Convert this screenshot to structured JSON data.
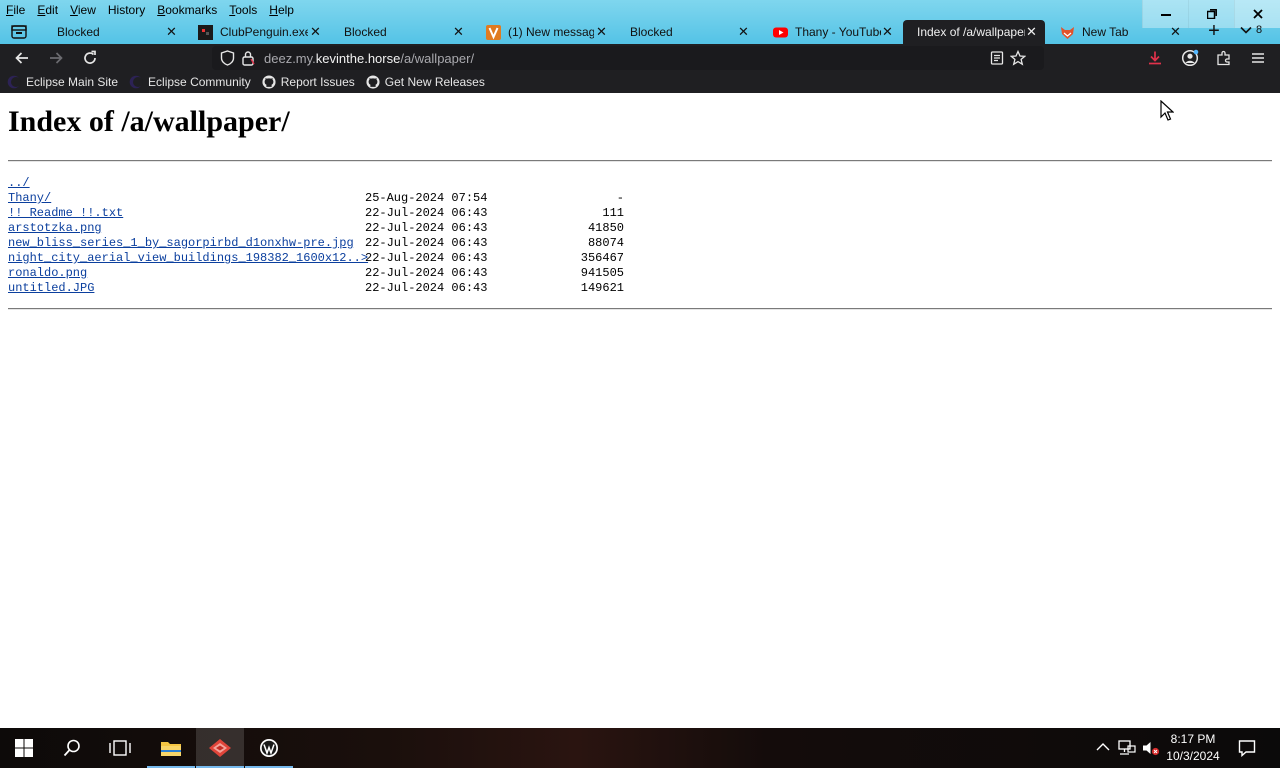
{
  "menubar": [
    "File",
    "Edit",
    "View",
    "History",
    "Bookmarks",
    "Tools",
    "Help"
  ],
  "tabs": [
    {
      "title": "Blocked",
      "icon": "none"
    },
    {
      "title": "ClubPenguin.exe",
      "icon": "clubpenguin-icon"
    },
    {
      "title": "Blocked",
      "icon": "none"
    },
    {
      "title": "(1) New message",
      "icon": "v-icon"
    },
    {
      "title": "Blocked",
      "icon": "none"
    },
    {
      "title": "Thany - YouTube",
      "icon": "youtube-icon"
    },
    {
      "title": "Index of /a/wallpaper/",
      "icon": "none",
      "active": true
    },
    {
      "title": "New Tab",
      "icon": "fox-icon"
    }
  ],
  "alltabs_count": "8",
  "url": {
    "prefix": "deez.my.",
    "host": "kevinthe.horse",
    "path": "/a/wallpaper/"
  },
  "bookmarks": [
    {
      "label": "Eclipse Main Site",
      "icon": "eclipse-icon"
    },
    {
      "label": "Eclipse Community",
      "icon": "eclipse-icon"
    },
    {
      "label": "Report Issues",
      "icon": "github-icon"
    },
    {
      "label": "Get New Releases",
      "icon": "github-icon"
    }
  ],
  "page": {
    "title": "Index of /a/wallpaper/",
    "parent_link": "../",
    "entries": [
      {
        "name": "Thany/",
        "date": "25-Aug-2024 07:54",
        "size": "-"
      },
      {
        "name": "!! Readme !!.txt",
        "date": "22-Jul-2024 06:43",
        "size": "111"
      },
      {
        "name": "arstotzka.png",
        "date": "22-Jul-2024 06:43",
        "size": "41850"
      },
      {
        "name": "new_bliss_series_1_by_sagorpirbd_d1onxhw-pre.jpg",
        "date": "22-Jul-2024 06:43",
        "size": "88074"
      },
      {
        "name": "night_city_aerial_view_buildings_198382_1600x12..>",
        "date": "22-Jul-2024 06:43",
        "size": "356467"
      },
      {
        "name": "ronaldo.png",
        "date": "22-Jul-2024 06:43",
        "size": "941505"
      },
      {
        "name": "untitled.JPG",
        "date": "22-Jul-2024 06:43",
        "size": "149621"
      }
    ]
  },
  "taskbar": {
    "time": "8:17 PM",
    "date": "10/3/2024",
    "accent": "#76b9ed"
  }
}
